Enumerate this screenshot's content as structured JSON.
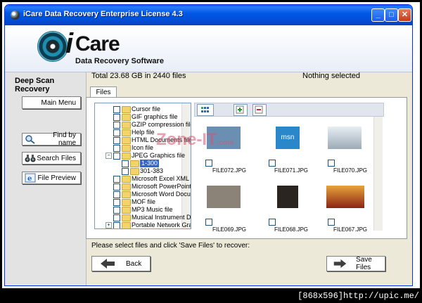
{
  "window": {
    "title": "iCare Data Recovery Enterprise License 4.3",
    "minimize": "_",
    "maximize": "□",
    "close": "✕"
  },
  "brand": {
    "i": "i",
    "care": "Care",
    "subtitle": "Data Recovery Software"
  },
  "left": {
    "title": "Deep Scan Recovery",
    "buttons": {
      "main_menu": "Main Menu",
      "find_by_name": "Find by name",
      "search_files": "Search Files",
      "file_preview": "File Preview"
    }
  },
  "info": {
    "total": "Total 23.68 GB in 2440 files",
    "selection": "Nothing selected"
  },
  "tabs": {
    "files": "Files"
  },
  "tree": [
    {
      "label": "Cursor file",
      "level": 1
    },
    {
      "label": "GIF graphics file",
      "level": 1
    },
    {
      "label": "GZIP compression file",
      "level": 1
    },
    {
      "label": "Help file",
      "level": 1
    },
    {
      "label": "HTML Documents file",
      "level": 1
    },
    {
      "label": "Icon file",
      "level": 1
    },
    {
      "label": "JPEG Graphics file",
      "level": 1,
      "expanded": true
    },
    {
      "label": "1-300",
      "level": 2,
      "selected": true
    },
    {
      "label": "301-383",
      "level": 2
    },
    {
      "label": "Microsoft Excel XML D",
      "level": 1
    },
    {
      "label": "Microsoft PowerPoint",
      "level": 1
    },
    {
      "label": "Microsoft Word Docun",
      "level": 1
    },
    {
      "label": "MOF file",
      "level": 1
    },
    {
      "label": "MP3 Music file",
      "level": 1
    },
    {
      "label": "Musical Instrument Di",
      "level": 1
    },
    {
      "label": "Portable Network Grap",
      "level": 1,
      "collapsed": true
    }
  ],
  "thumbs": [
    {
      "name": "FILE072.JPG",
      "color": "#6A8FB2"
    },
    {
      "name": "FILE071.JPG",
      "color": "#2A87C9"
    },
    {
      "name": "FILE070.JPG",
      "color": "#C9D6E2"
    },
    {
      "name": "FILE069.JPG",
      "color": "#8C8378"
    },
    {
      "name": "FILE068.JPG",
      "color": "#2B2522"
    },
    {
      "name": "FILE067.JPG",
      "color": "#B4411A"
    }
  ],
  "thumb_text": {
    "msn": "msn"
  },
  "prompt": "Please select files and click 'Save Files' to recover:",
  "nav": {
    "back": "Back",
    "save": "Save Files"
  },
  "overlay": {
    "watermark_logo": "Zone-IT",
    "watermark_sub": ".com",
    "footer": "[868x596]http://upic.me/"
  },
  "colors": {
    "title_bar": "#0058E6",
    "selection": "#316AC5",
    "window_bg": "#ECE9D8"
  }
}
